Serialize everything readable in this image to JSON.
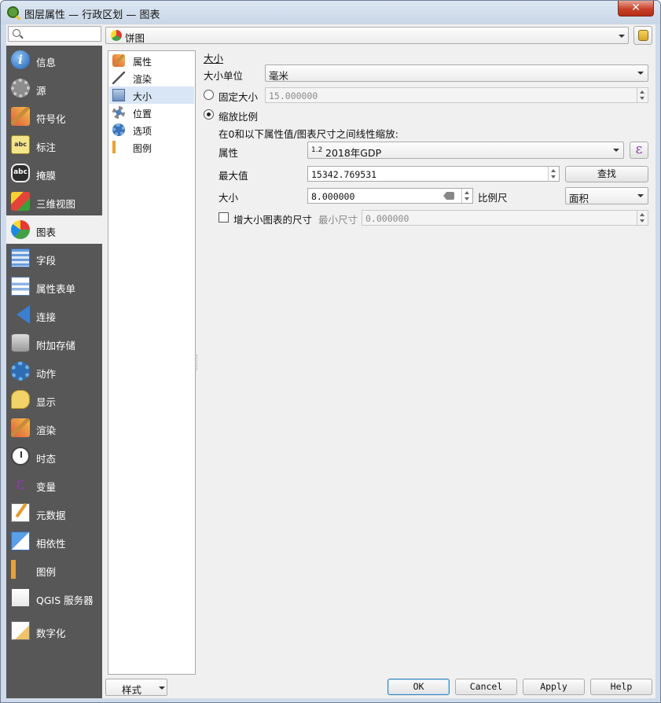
{
  "window": {
    "title": "图层属性 — 行政区划 — 图表",
    "close": "✕"
  },
  "search": {
    "placeholder": ""
  },
  "nav": [
    {
      "label": "信息",
      "icon": "info-icon"
    },
    {
      "label": "源",
      "icon": "source-icon"
    },
    {
      "label": "符号化",
      "icon": "symbology-icon"
    },
    {
      "label": "标注",
      "icon": "labels-icon",
      "glyph": "abc"
    },
    {
      "label": "掩膜",
      "icon": "mask-icon",
      "glyph": "abc"
    },
    {
      "label": "三维视图",
      "icon": "3d-view-icon"
    },
    {
      "label": "图表",
      "icon": "diagram-icon",
      "active": true
    },
    {
      "label": "字段",
      "icon": "fields-icon"
    },
    {
      "label": "属性表单",
      "icon": "attribute-form-icon"
    },
    {
      "label": "连接",
      "icon": "joins-icon"
    },
    {
      "label": "附加存储",
      "icon": "auxiliary-storage-icon"
    },
    {
      "label": "动作",
      "icon": "actions-icon"
    },
    {
      "label": "显示",
      "icon": "display-icon"
    },
    {
      "label": "渲染",
      "icon": "rendering-icon"
    },
    {
      "label": "时态",
      "icon": "temporal-icon"
    },
    {
      "label": "变量",
      "icon": "variables-icon",
      "glyph": "ε"
    },
    {
      "label": "元数据",
      "icon": "metadata-icon"
    },
    {
      "label": "相依性",
      "icon": "dependencies-icon"
    },
    {
      "label": "图例",
      "icon": "legend-icon"
    },
    {
      "label": "QGIS 服务器",
      "icon": "qgis-server-icon"
    },
    {
      "label": "数字化",
      "icon": "digitizing-icon"
    }
  ],
  "renderer": {
    "value": "饼图"
  },
  "subnav": [
    {
      "label": "属性",
      "icon": "attributes-icon"
    },
    {
      "label": "渲染",
      "icon": "render-icon"
    },
    {
      "label": "大小",
      "icon": "size-icon",
      "active": true
    },
    {
      "label": "位置",
      "icon": "placement-icon"
    },
    {
      "label": "选项",
      "icon": "options-icon"
    },
    {
      "label": "图例",
      "icon": "legend-icon"
    }
  ],
  "size": {
    "section_title": "大小",
    "unit_label": "大小单位",
    "unit_value": "毫米",
    "fixed_label": "固定大小",
    "fixed_value": "15.000000",
    "scaled_label": "缩放比例",
    "scale_desc": "在0和以下属性值/图表尺寸之间线性缩放:",
    "attribute_label": "属性",
    "attribute_prefix": "1.2",
    "attribute_value": "2018年GDP",
    "max_label": "最大值",
    "max_value": "15342.769531",
    "find_button": "查找",
    "size_label": "大小",
    "size_value": "8.000000",
    "scale_label": "比例尺",
    "scale_value": "面积",
    "increase_label": "增大小图表的尺寸",
    "min_size_label": "最小尺寸",
    "min_size_value": "0.000000",
    "expression_glyph": "ε"
  },
  "footer": {
    "style_button": "样式",
    "ok": "OK",
    "cancel": "Cancel",
    "apply": "Apply",
    "help": "Help"
  }
}
